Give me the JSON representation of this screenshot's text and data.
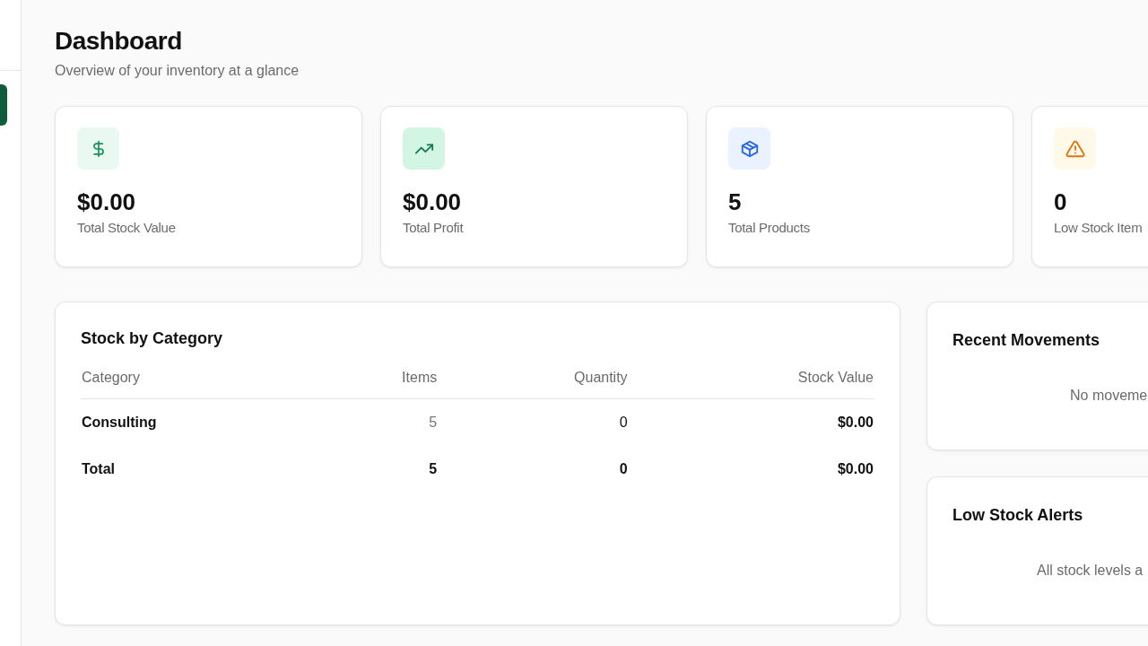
{
  "page": {
    "title": "Dashboard",
    "subtitle": "Overview of your inventory at a glance"
  },
  "stats": [
    {
      "kind": "dollar",
      "value": "$0.00",
      "label": "Total Stock Value"
    },
    {
      "kind": "trend",
      "value": "$0.00",
      "label": "Total Profit"
    },
    {
      "kind": "box",
      "value": "5",
      "label": "Total Products"
    },
    {
      "kind": "warning",
      "value": "0",
      "label": "Low Stock Item"
    }
  ],
  "stock_by_category": {
    "title": "Stock by Category",
    "columns": [
      "Category",
      "Items",
      "Quantity",
      "Stock Value"
    ],
    "rows": [
      {
        "kind": "category",
        "cells": [
          "Consulting",
          "5",
          "0",
          "$0.00"
        ]
      },
      {
        "kind": "total",
        "cells": [
          "Total",
          "5",
          "0",
          "$0.00"
        ]
      }
    ]
  },
  "recent_movements": {
    "title": "Recent Movements",
    "empty_text": "No moveme"
  },
  "low_stock_alerts": {
    "title": "Low Stock Alerts",
    "empty_text": "All stock levels a"
  }
}
